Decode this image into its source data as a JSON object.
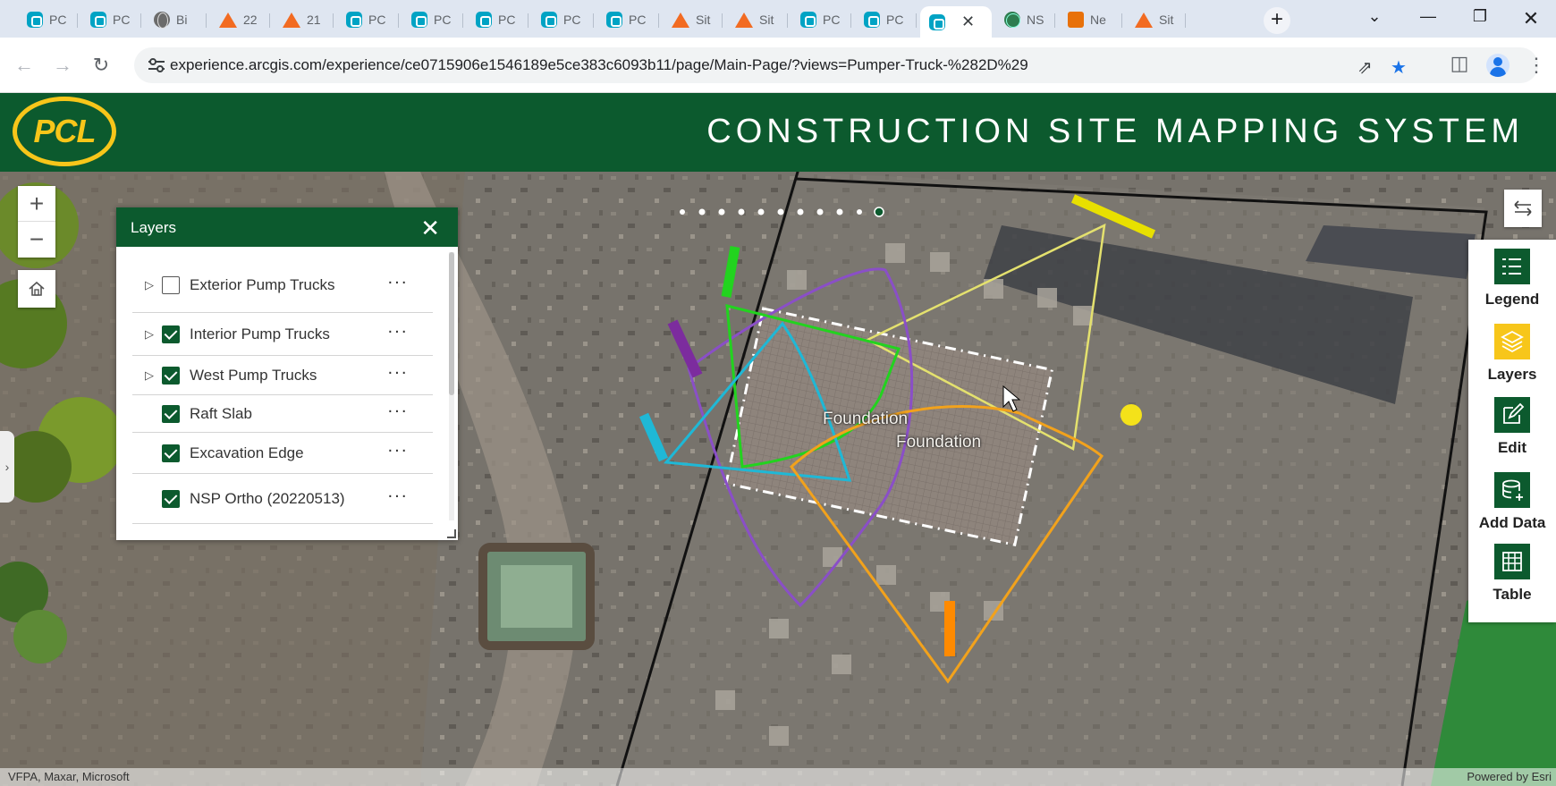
{
  "browser": {
    "tabs": [
      {
        "label": "PC",
        "icon": "arcgis-experience-icon"
      },
      {
        "label": "PC",
        "icon": "arcgis-experience-icon"
      },
      {
        "label": "Bi",
        "icon": "globe-icon"
      },
      {
        "label": "22",
        "icon": "survey123-icon"
      },
      {
        "label": "21",
        "icon": "survey123-icon"
      },
      {
        "label": "PC",
        "icon": "arcgis-experience-icon"
      },
      {
        "label": "PC",
        "icon": "arcgis-experience-icon"
      },
      {
        "label": "PC",
        "icon": "arcgis-experience-icon"
      },
      {
        "label": "PC",
        "icon": "arcgis-experience-icon"
      },
      {
        "label": "PC",
        "icon": "arcgis-experience-icon"
      },
      {
        "label": "Sit",
        "icon": "survey123-icon"
      },
      {
        "label": "Sit",
        "icon": "survey123-icon"
      },
      {
        "label": "PC",
        "icon": "arcgis-experience-icon"
      },
      {
        "label": "PC",
        "icon": "arcgis-experience-icon"
      },
      {
        "label": "",
        "icon": "arcgis-experience-icon",
        "active": true
      },
      {
        "label": "NS",
        "icon": "ns-icon"
      },
      {
        "label": "Ne",
        "icon": "news-icon"
      },
      {
        "label": "Sit",
        "icon": "survey123-icon"
      }
    ],
    "new_tab_label": "+",
    "url": "experience.arcgis.com/experience/ce0715906e1546189e5ce383c6093b11/page/Main-Page/?views=Pumper-Truck-%282D%29"
  },
  "app": {
    "logo_text": "PCL",
    "title": "CONSTRUCTION SITE MAPPING SYSTEM",
    "brand_green": "#0c5a2e",
    "brand_yellow": "#f7c61a"
  },
  "map": {
    "labels": [
      "Foundation",
      "Foundation"
    ],
    "attribution_left": "VFPA, Maxar, Microsoft",
    "attribution_right": "Powered by Esri",
    "zoom_in": "+",
    "zoom_out": "−"
  },
  "layers_panel": {
    "title": "Layers",
    "items": [
      {
        "label": "Exterior Pump Trucks",
        "checked": false,
        "expandable": true
      },
      {
        "label": "Interior Pump Trucks",
        "checked": true,
        "expandable": true
      },
      {
        "label": "West Pump Trucks",
        "checked": true,
        "expandable": true
      },
      {
        "label": "Raft Slab",
        "checked": true,
        "expandable": false
      },
      {
        "label": "Excavation Edge",
        "checked": true,
        "expandable": false
      },
      {
        "label": "NSP Ortho (20220513)",
        "checked": true,
        "expandable": false
      }
    ],
    "more_label": "···"
  },
  "toolbar": {
    "items": [
      {
        "label": "Legend",
        "icon": "legend-icon",
        "active": false
      },
      {
        "label": "Layers",
        "icon": "layers-icon",
        "active": true
      },
      {
        "label": "Edit",
        "icon": "edit-icon",
        "active": false
      },
      {
        "label": "Add Data",
        "icon": "add-data-icon",
        "active": false
      },
      {
        "label": "Table",
        "icon": "table-icon",
        "active": false
      }
    ]
  }
}
